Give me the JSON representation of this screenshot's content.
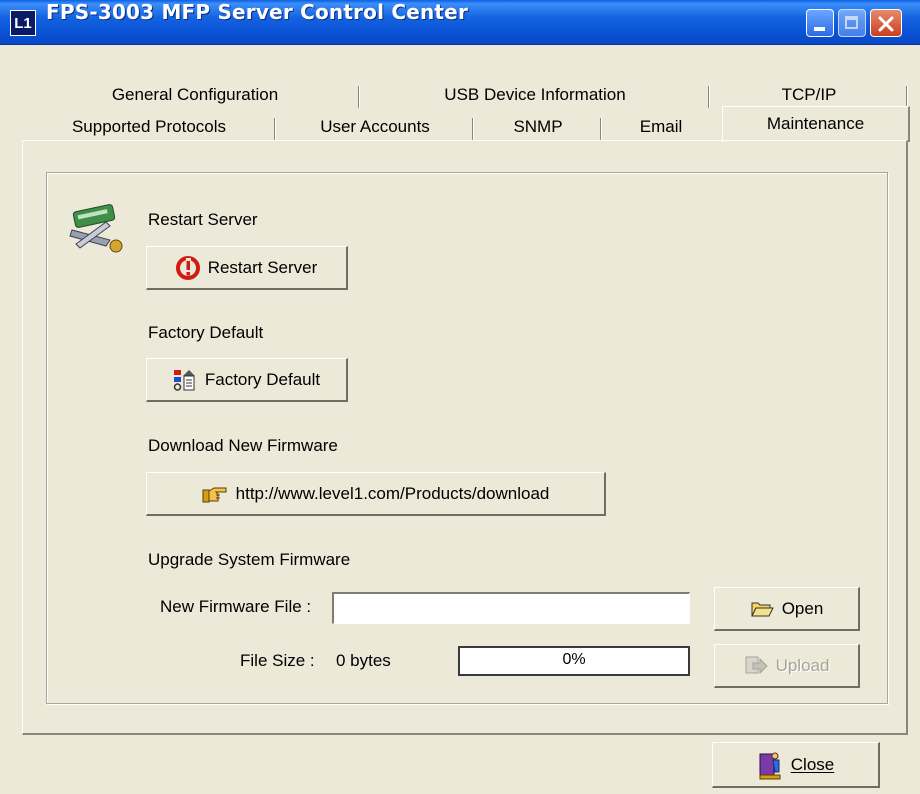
{
  "window": {
    "title": "FPS-3003 MFP Server Control Center",
    "app_icon": "L1"
  },
  "tabs": {
    "row1": [
      "General Configuration",
      "USB Device Information",
      "TCP/IP"
    ],
    "row2": [
      "Supported Protocols",
      "User Accounts",
      "SNMP",
      "Email",
      "Maintenance"
    ],
    "active": "Maintenance"
  },
  "maintenance": {
    "restart": {
      "section_label": "Restart Server",
      "button_label": "Restart Server"
    },
    "factory": {
      "section_label": "Factory Default",
      "button_label": "Factory Default"
    },
    "download": {
      "section_label": "Download New Firmware",
      "button_label": "http://www.level1.com/Products/download"
    },
    "upgrade": {
      "section_label": "Upgrade System Firmware",
      "file_label": "New Firmware File :",
      "file_value": "",
      "size_label": "File Size :",
      "size_value": "0 bytes",
      "progress_text": "0%",
      "progress": 0,
      "open_label": "Open",
      "upload_label": "Upload"
    }
  },
  "footer": {
    "close_label": "Close"
  },
  "icons": [
    "app-logo-icon",
    "minimize-icon",
    "maximize-icon",
    "close-window-icon",
    "tools-icon",
    "restart-icon",
    "factory-default-icon",
    "pointing-hand-icon",
    "folder-open-icon",
    "upload-icon",
    "exit-door-icon"
  ],
  "colors": {
    "titlebar": "#0a52d6",
    "window_bg": "#ece9d8",
    "close_button": "#c8401f"
  }
}
